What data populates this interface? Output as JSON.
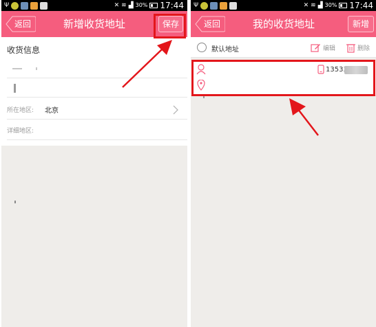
{
  "statusbar": {
    "time": "17:44",
    "battery": "30%"
  },
  "left_screen": {
    "header": {
      "back_label": "返回",
      "title": "新增收货地址",
      "save_label": "保存"
    },
    "form": {
      "section_title": "收货信息",
      "region_label": "所在地区:",
      "region_value": "北京",
      "detail_label": "详细地区:"
    }
  },
  "right_screen": {
    "header": {
      "back_label": "返回",
      "title": "我的收货地址",
      "add_label": "新增"
    },
    "default_label": "默认地址",
    "edit_label": "编辑",
    "delete_label": "删除",
    "phone_visible": "13533"
  },
  "colors": {
    "header": "#f55d7e",
    "highlight": "#e3161b",
    "background": "#efedea"
  }
}
